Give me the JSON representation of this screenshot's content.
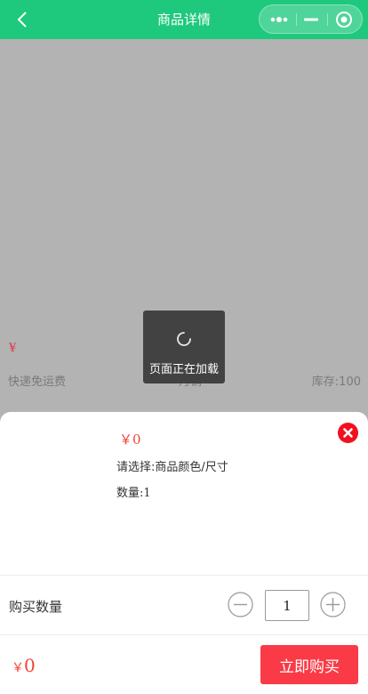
{
  "header": {
    "title": "商品详情",
    "back_icon": "chevron-left-icon",
    "capsule_icons": [
      "more-dots-icon",
      "minimize-icon",
      "close-circle-icon"
    ],
    "background_color": "#1ec97d"
  },
  "product_behind": {
    "price_symbol": "¥",
    "shipping": "快递免运费",
    "sales": "月销",
    "stock": "库存:100"
  },
  "toast": {
    "text": "页面正在加载",
    "icon": "loading-spinner-icon"
  },
  "sku_sheet": {
    "price": "￥0",
    "select_prompt": "请选择:商品颜色/尺寸",
    "quantity_text": "数量:1",
    "close_icon": "close-circle-icon",
    "buy_quantity_label": "购买数量",
    "quantity_value": "1",
    "minus_icon": "minus-circle-icon",
    "plus_icon": "plus-circle-icon",
    "total_symbol": "￥",
    "total_amount": "0",
    "buy_now_label": "立即购买",
    "accent_color": "#fa3a46"
  }
}
